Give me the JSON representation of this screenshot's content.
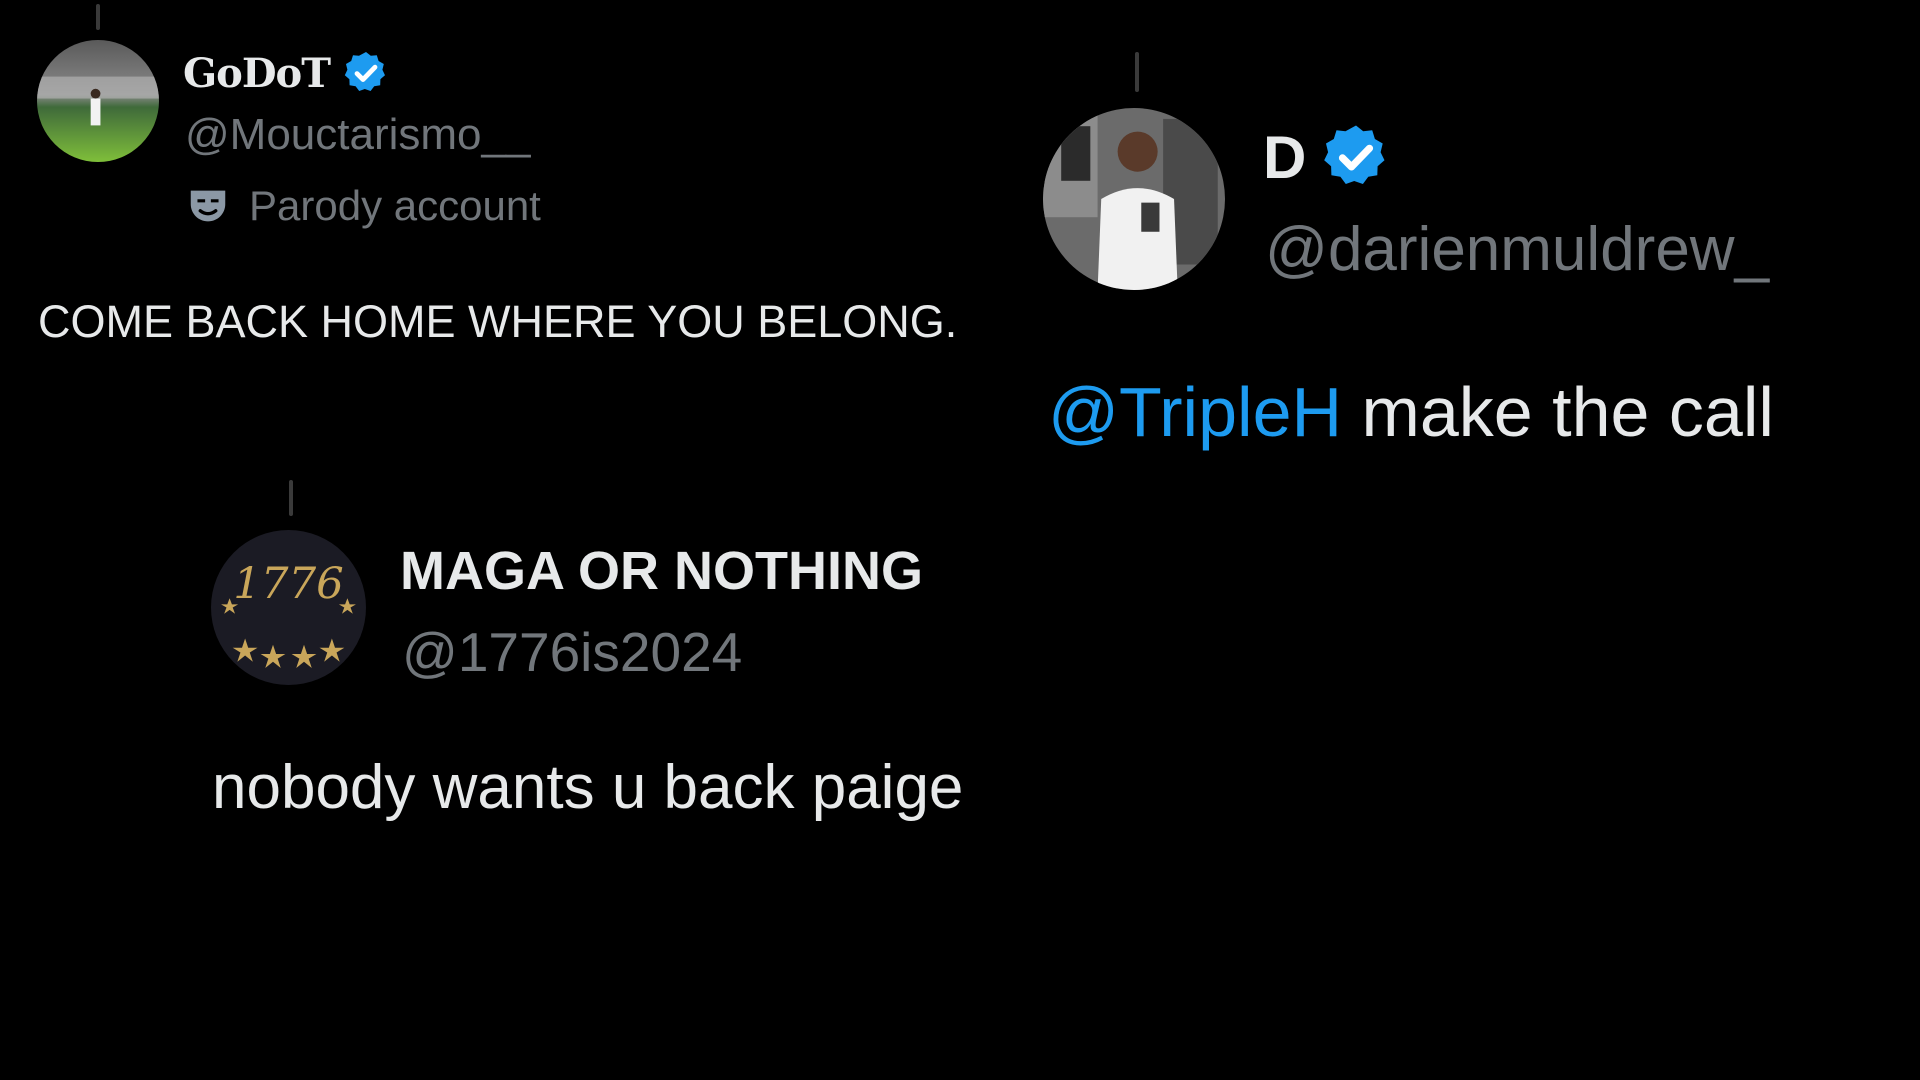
{
  "tweets": [
    {
      "display_name": "GoDoT",
      "handle": "@Mouctarismo__",
      "verified": true,
      "badge_label": "Parody account",
      "badge_icon": "theater-mask-icon",
      "text": "COME BACK HOME WHERE YOU BELONG."
    },
    {
      "display_name": "D",
      "handle": "@darienmuldrew_",
      "verified": true,
      "mention": "@TripleH",
      "text_rest": " make the call"
    },
    {
      "display_name": "MAGA OR NOTHING",
      "handle": "@1776is2024",
      "verified": false,
      "avatar_text": "1776",
      "text": "nobody wants u back paige"
    }
  ],
  "colors": {
    "background": "#000000",
    "primary_text": "#e7e9ea",
    "secondary_text": "#71767b",
    "accent": "#1d9bf0"
  }
}
